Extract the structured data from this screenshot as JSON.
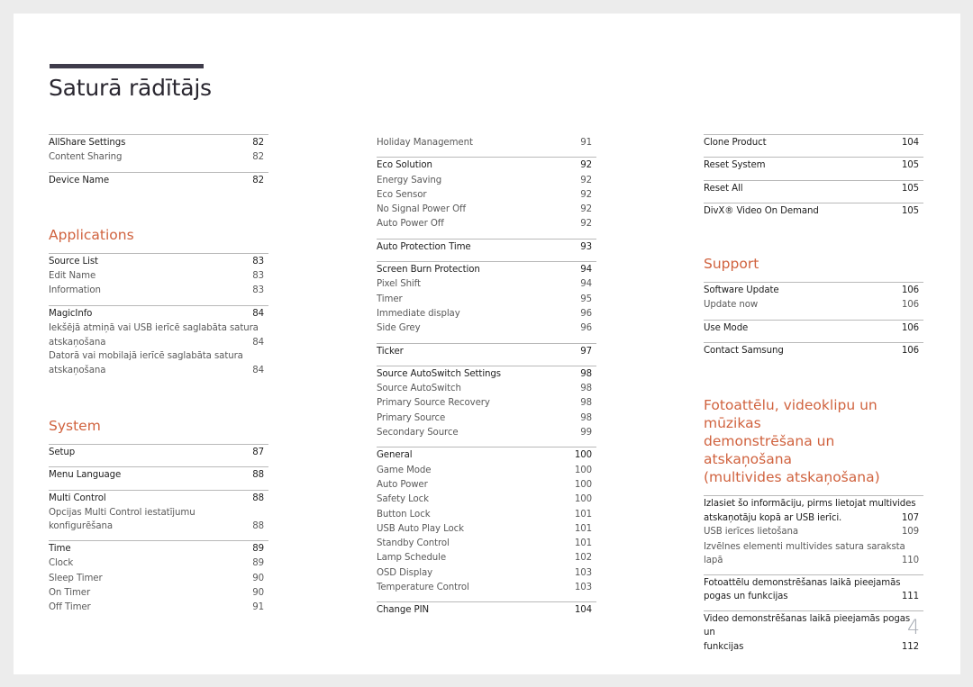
{
  "page": {
    "title": "Saturā rādītājs",
    "page_number": "4",
    "accent_color": "#d0623e",
    "title_bar_color": "#3f3c4b"
  },
  "col1": {
    "groups_top": [
      {
        "items": [
          {
            "label": "AllShare Settings",
            "page": "82",
            "main": true
          },
          {
            "label": "Content Sharing",
            "page": "82",
            "main": false
          }
        ]
      },
      {
        "items": [
          {
            "label": "Device Name",
            "page": "82",
            "main": true
          }
        ]
      }
    ],
    "applications": {
      "heading": "Applications",
      "groups": [
        {
          "items": [
            {
              "label": "Source List",
              "page": "83",
              "main": true
            },
            {
              "label": "Edit Name",
              "page": "83",
              "main": false
            },
            {
              "label": "Information",
              "page": "83",
              "main": false
            }
          ]
        },
        {
          "items": [
            {
              "label": "MagicInfo",
              "page": "84",
              "main": true
            },
            {
              "label_line1": "Iekšējā atmiņā vai USB ierīcē saglabāta satura",
              "label_line2": "atskaņošana",
              "page": "84",
              "main": false
            },
            {
              "label_line1": "Datorā vai mobilajā ierīcē saglabāta satura",
              "label_line2": "atskaņošana",
              "page": "84",
              "main": false
            }
          ]
        }
      ]
    },
    "system": {
      "heading": "System",
      "groups": [
        {
          "items": [
            {
              "label": "Setup",
              "page": "87",
              "main": true
            }
          ]
        },
        {
          "items": [
            {
              "label": "Menu Language",
              "page": "88",
              "main": true
            }
          ]
        },
        {
          "items": [
            {
              "label": "Multi Control",
              "page": "88",
              "main": true
            },
            {
              "label_line1": "Opcijas Multi Control iestatījumu",
              "label_line2": "konfigurēšana",
              "page": "88",
              "main": false
            }
          ]
        },
        {
          "items": [
            {
              "label": "Time",
              "page": "89",
              "main": true
            },
            {
              "label": "Clock",
              "page": "89",
              "main": false
            },
            {
              "label": "Sleep Timer",
              "page": "90",
              "main": false
            },
            {
              "label": "On Timer",
              "page": "90",
              "main": false
            },
            {
              "label": "Off Timer",
              "page": "91",
              "main": false
            }
          ]
        }
      ]
    }
  },
  "col2": {
    "groups": [
      {
        "items": [
          {
            "label": "Holiday Management",
            "page": "91",
            "main": false
          }
        ]
      },
      {
        "items": [
          {
            "label": "Eco Solution",
            "page": "92",
            "main": true
          },
          {
            "label": "Energy Saving",
            "page": "92",
            "main": false
          },
          {
            "label": "Eco Sensor",
            "page": "92",
            "main": false
          },
          {
            "label": "No Signal Power Off",
            "page": "92",
            "main": false
          },
          {
            "label": "Auto Power Off",
            "page": "92",
            "main": false
          }
        ]
      },
      {
        "items": [
          {
            "label": "Auto Protection Time",
            "page": "93",
            "main": true
          }
        ]
      },
      {
        "items": [
          {
            "label": "Screen Burn Protection",
            "page": "94",
            "main": true
          },
          {
            "label": "Pixel Shift",
            "page": "94",
            "main": false
          },
          {
            "label": "Timer",
            "page": "95",
            "main": false
          },
          {
            "label": "Immediate display",
            "page": "96",
            "main": false
          },
          {
            "label": "Side Grey",
            "page": "96",
            "main": false
          }
        ]
      },
      {
        "items": [
          {
            "label": "Ticker",
            "page": "97",
            "main": true
          }
        ]
      },
      {
        "items": [
          {
            "label": "Source AutoSwitch Settings",
            "page": "98",
            "main": true
          },
          {
            "label": "Source AutoSwitch",
            "page": "98",
            "main": false
          },
          {
            "label": "Primary Source Recovery",
            "page": "98",
            "main": false
          },
          {
            "label": "Primary Source",
            "page": "98",
            "main": false
          },
          {
            "label": "Secondary Source",
            "page": "99",
            "main": false
          }
        ]
      },
      {
        "items": [
          {
            "label": "General",
            "page": "100",
            "main": true
          },
          {
            "label": "Game Mode",
            "page": "100",
            "main": false
          },
          {
            "label": "Auto Power",
            "page": "100",
            "main": false
          },
          {
            "label": "Safety Lock",
            "page": "100",
            "main": false
          },
          {
            "label": "Button Lock",
            "page": "101",
            "main": false
          },
          {
            "label": "USB Auto Play Lock",
            "page": "101",
            "main": false
          },
          {
            "label": "Standby Control",
            "page": "101",
            "main": false
          },
          {
            "label": "Lamp Schedule",
            "page": "102",
            "main": false
          },
          {
            "label": "OSD Display",
            "page": "103",
            "main": false
          },
          {
            "label": "Temperature Control",
            "page": "103",
            "main": false
          }
        ]
      },
      {
        "items": [
          {
            "label": "Change PIN",
            "page": "104",
            "main": true
          }
        ]
      }
    ]
  },
  "col3": {
    "groups_top": [
      {
        "items": [
          {
            "label": "Clone Product",
            "page": "104",
            "main": true
          }
        ]
      },
      {
        "items": [
          {
            "label": "Reset System",
            "page": "105",
            "main": true
          }
        ]
      },
      {
        "items": [
          {
            "label": "Reset All",
            "page": "105",
            "main": true
          }
        ]
      },
      {
        "items": [
          {
            "label": "DivX® Video On Demand",
            "page": "105",
            "main": true
          }
        ]
      }
    ],
    "support": {
      "heading": "Support",
      "groups": [
        {
          "items": [
            {
              "label": "Software Update",
              "page": "106",
              "main": true
            },
            {
              "label": "Update now",
              "page": "106",
              "main": false
            }
          ]
        },
        {
          "items": [
            {
              "label": "Use Mode",
              "page": "106",
              "main": true
            }
          ]
        },
        {
          "items": [
            {
              "label": "Contact Samsung",
              "page": "106",
              "main": true
            }
          ]
        }
      ]
    },
    "media": {
      "heading_line1": "Fotoattēlu, videoklipu un mūzikas",
      "heading_line2": "demonstrēšana un atskaņošana",
      "heading_line3": "(multivides atskaņošana)",
      "groups": [
        {
          "items": [
            {
              "label_line1": "Izlasiet šo informāciju, pirms lietojat multivides",
              "label_line2": "atskaņotāju kopā ar USB ierīci.",
              "page": "107",
              "main": true
            },
            {
              "label": "USB ierīces lietošana",
              "page": "109",
              "main": false
            },
            {
              "label_line1": "Izvēlnes elementi multivides satura saraksta",
              "label_line2": "lapā",
              "page": "110",
              "main": false
            }
          ]
        },
        {
          "items": [
            {
              "label_line1": "Fotoattēlu demonstrēšanas laikā pieejamās",
              "label_line2": "pogas un funkcijas",
              "page": "111",
              "main": true
            }
          ]
        },
        {
          "items": [
            {
              "label_line1": "Video demonstrēšanas laikā pieejamās pogas un",
              "label_line2": "funkcijas",
              "page": "112",
              "main": true
            }
          ]
        }
      ]
    }
  }
}
